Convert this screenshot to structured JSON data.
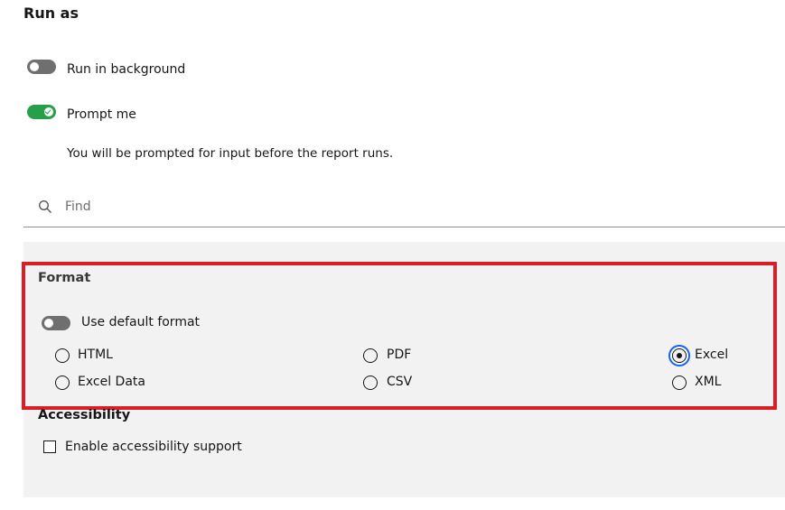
{
  "page": {
    "title": "Run as"
  },
  "toggles": {
    "run_in_background": {
      "label": "Run in background",
      "on": false
    },
    "prompt_me": {
      "label": "Prompt me",
      "on": true,
      "helper": "You will be prompted for input before the report runs."
    }
  },
  "search": {
    "placeholder": "Find",
    "value": ""
  },
  "format": {
    "title": "Format",
    "default_toggle": {
      "label": "Use default format",
      "on": false
    },
    "options": [
      "HTML",
      "PDF",
      "Excel",
      "Excel Data",
      "CSV",
      "XML"
    ],
    "selected": "Excel"
  },
  "accessibility": {
    "title": "Accessibility",
    "checkbox_label": "Enable accessibility support",
    "checked": false
  },
  "colors": {
    "toggle_on": "#24a148",
    "toggle_off": "#6f6f6f",
    "highlight_border": "#da1e28",
    "focus_ring": "#0f62fe",
    "panel_bg": "#f2f2f2"
  },
  "icons": {
    "search": "search-icon",
    "toggle_check": "checkmark-icon"
  }
}
